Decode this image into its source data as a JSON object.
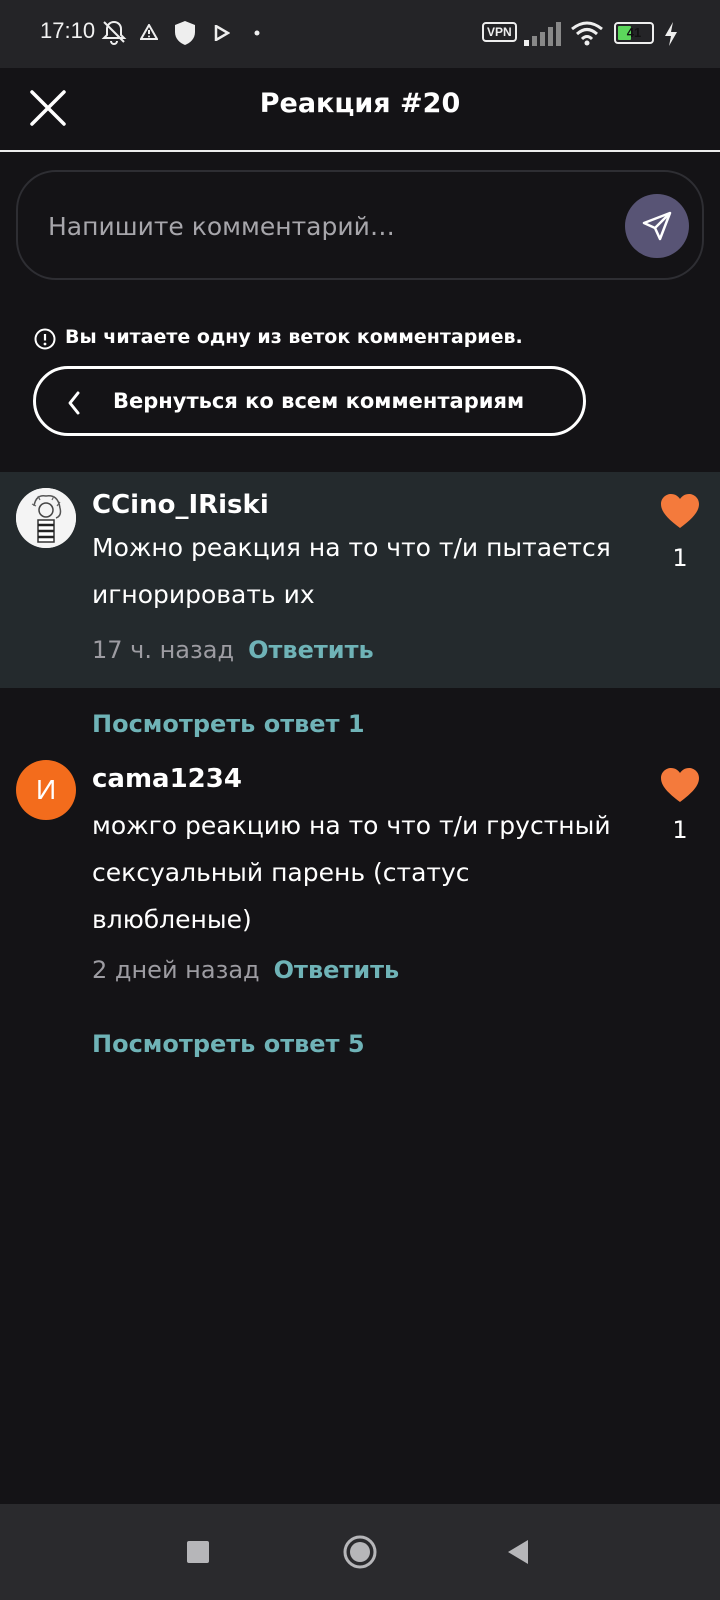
{
  "status_bar": {
    "time": "17:10",
    "vpn": "VPN",
    "battery": "41",
    "battery_level_percent": 41,
    "icons": [
      "bell-off-icon",
      "warning-icon",
      "shield-icon",
      "play-icon",
      "dot-icon",
      "signal-icon",
      "wifi-icon",
      "battery-icon",
      "charging-icon"
    ]
  },
  "header": {
    "title": "Реакция #20",
    "close_icon": "close-icon"
  },
  "composer": {
    "placeholder": "Напишите комментарий…",
    "send_icon": "send-icon"
  },
  "thread_notice": {
    "text": "Вы читаете одну из веток комментариев.",
    "icon": "info-icon"
  },
  "back_button": {
    "label": "Вернуться ко всем комментариям",
    "icon": "chevron-left-icon"
  },
  "comments": [
    {
      "username": "CCino_IRiski",
      "text": "Можно реакция на то что т/и пытается игнорировать их",
      "time": "17 ч. назад",
      "reply_label": "Ответить",
      "likes": "1",
      "avatar": "drawing",
      "highlighted": true,
      "view_replies": "Посмотреть ответ 1"
    },
    {
      "username": "cama1234",
      "text": "можго реакцию на то что т/и грустный сексуальный парень (статус влюбленые)",
      "time": "2 дней назад",
      "reply_label": "Ответить",
      "likes": "1",
      "avatar_letter": "И",
      "highlighted": false,
      "view_replies": "Посмотреть ответ 5"
    }
  ],
  "colors": {
    "background": "#141316",
    "accent_teal": "#6fb3b7",
    "heart": "#f47a3c",
    "send_button": "#585475",
    "avatar_orange": "#f36c1c",
    "highlight_row": "#242a2d"
  },
  "nav_bar": {
    "icons": [
      "square-icon",
      "circle-icon",
      "back-triangle-icon"
    ]
  }
}
